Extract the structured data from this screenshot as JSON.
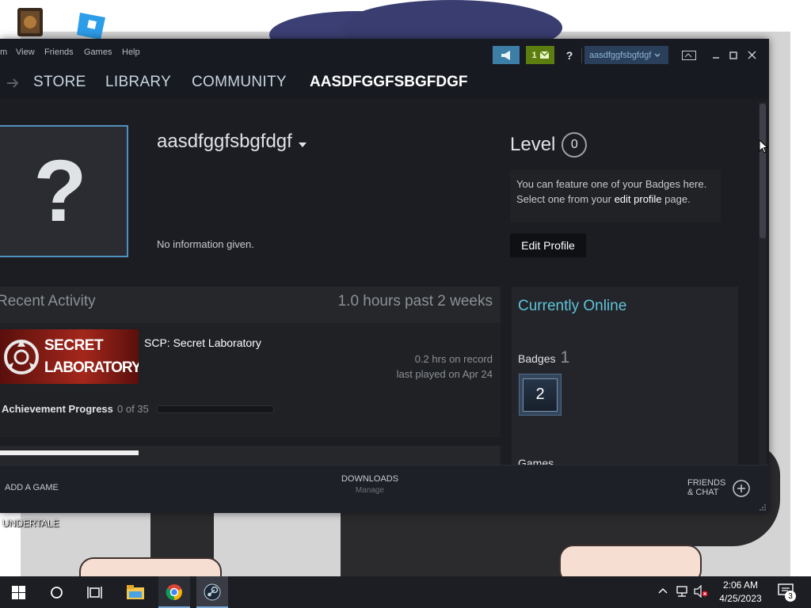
{
  "colors": {
    "accent": "#66c0f4",
    "steam_dark": "#171a21",
    "notify_green": "#5c7e10",
    "notify_blue": "#3d7ea6"
  },
  "desktop": {
    "shortcut_label": "UNDERTALE"
  },
  "menu": {
    "items": [
      "m",
      "View",
      "Friends",
      "Games",
      "Help"
    ]
  },
  "titlebar": {
    "notification_count": "1",
    "help_label": "?",
    "account_name": "aasdfggfsbgfdgf"
  },
  "nav": {
    "store": "STORE",
    "library": "LIBRARY",
    "community": "COMMUNITY",
    "profile": "AASDFGGFSBGFDGF"
  },
  "profile": {
    "persona_name": "aasdfggfsbgfdgf",
    "summary": "No information given.",
    "avatar_placeholder": "?",
    "level_label": "Level",
    "level_value": "0",
    "badge_hint_line1": "You can feature one of your Badges here.",
    "badge_hint_prefix": "Select one from your ",
    "badge_hint_link": "edit profile",
    "badge_hint_suffix": " page.",
    "edit_profile_label": "Edit Profile"
  },
  "recent_activity": {
    "title": "Recent Activity",
    "summary": "1.0 hours past 2 weeks",
    "game": {
      "name": "SCP: Secret Laboratory",
      "capsule_line1": "SECRET",
      "capsule_line2": "LABORATORY",
      "hours": "0.2 hrs on record",
      "last_played": "last played on Apr 24",
      "achievement_label": "Achievement Progress",
      "achievement_count": "0 of 35",
      "achievement_progress": 0
    }
  },
  "sidebar": {
    "status": "Currently Online",
    "badges_label": "Badges",
    "badges_count": "1",
    "badge_value": "2",
    "games_label": "Games"
  },
  "footer": {
    "add_game": "ADD A GAME",
    "downloads": "DOWNLOADS",
    "downloads_sub": "Manage",
    "friends_line1": "FRIENDS",
    "friends_line2": "& CHAT"
  },
  "taskbar": {
    "time": "2:06 AM",
    "date": "4/25/2023",
    "notification_count": "3"
  }
}
